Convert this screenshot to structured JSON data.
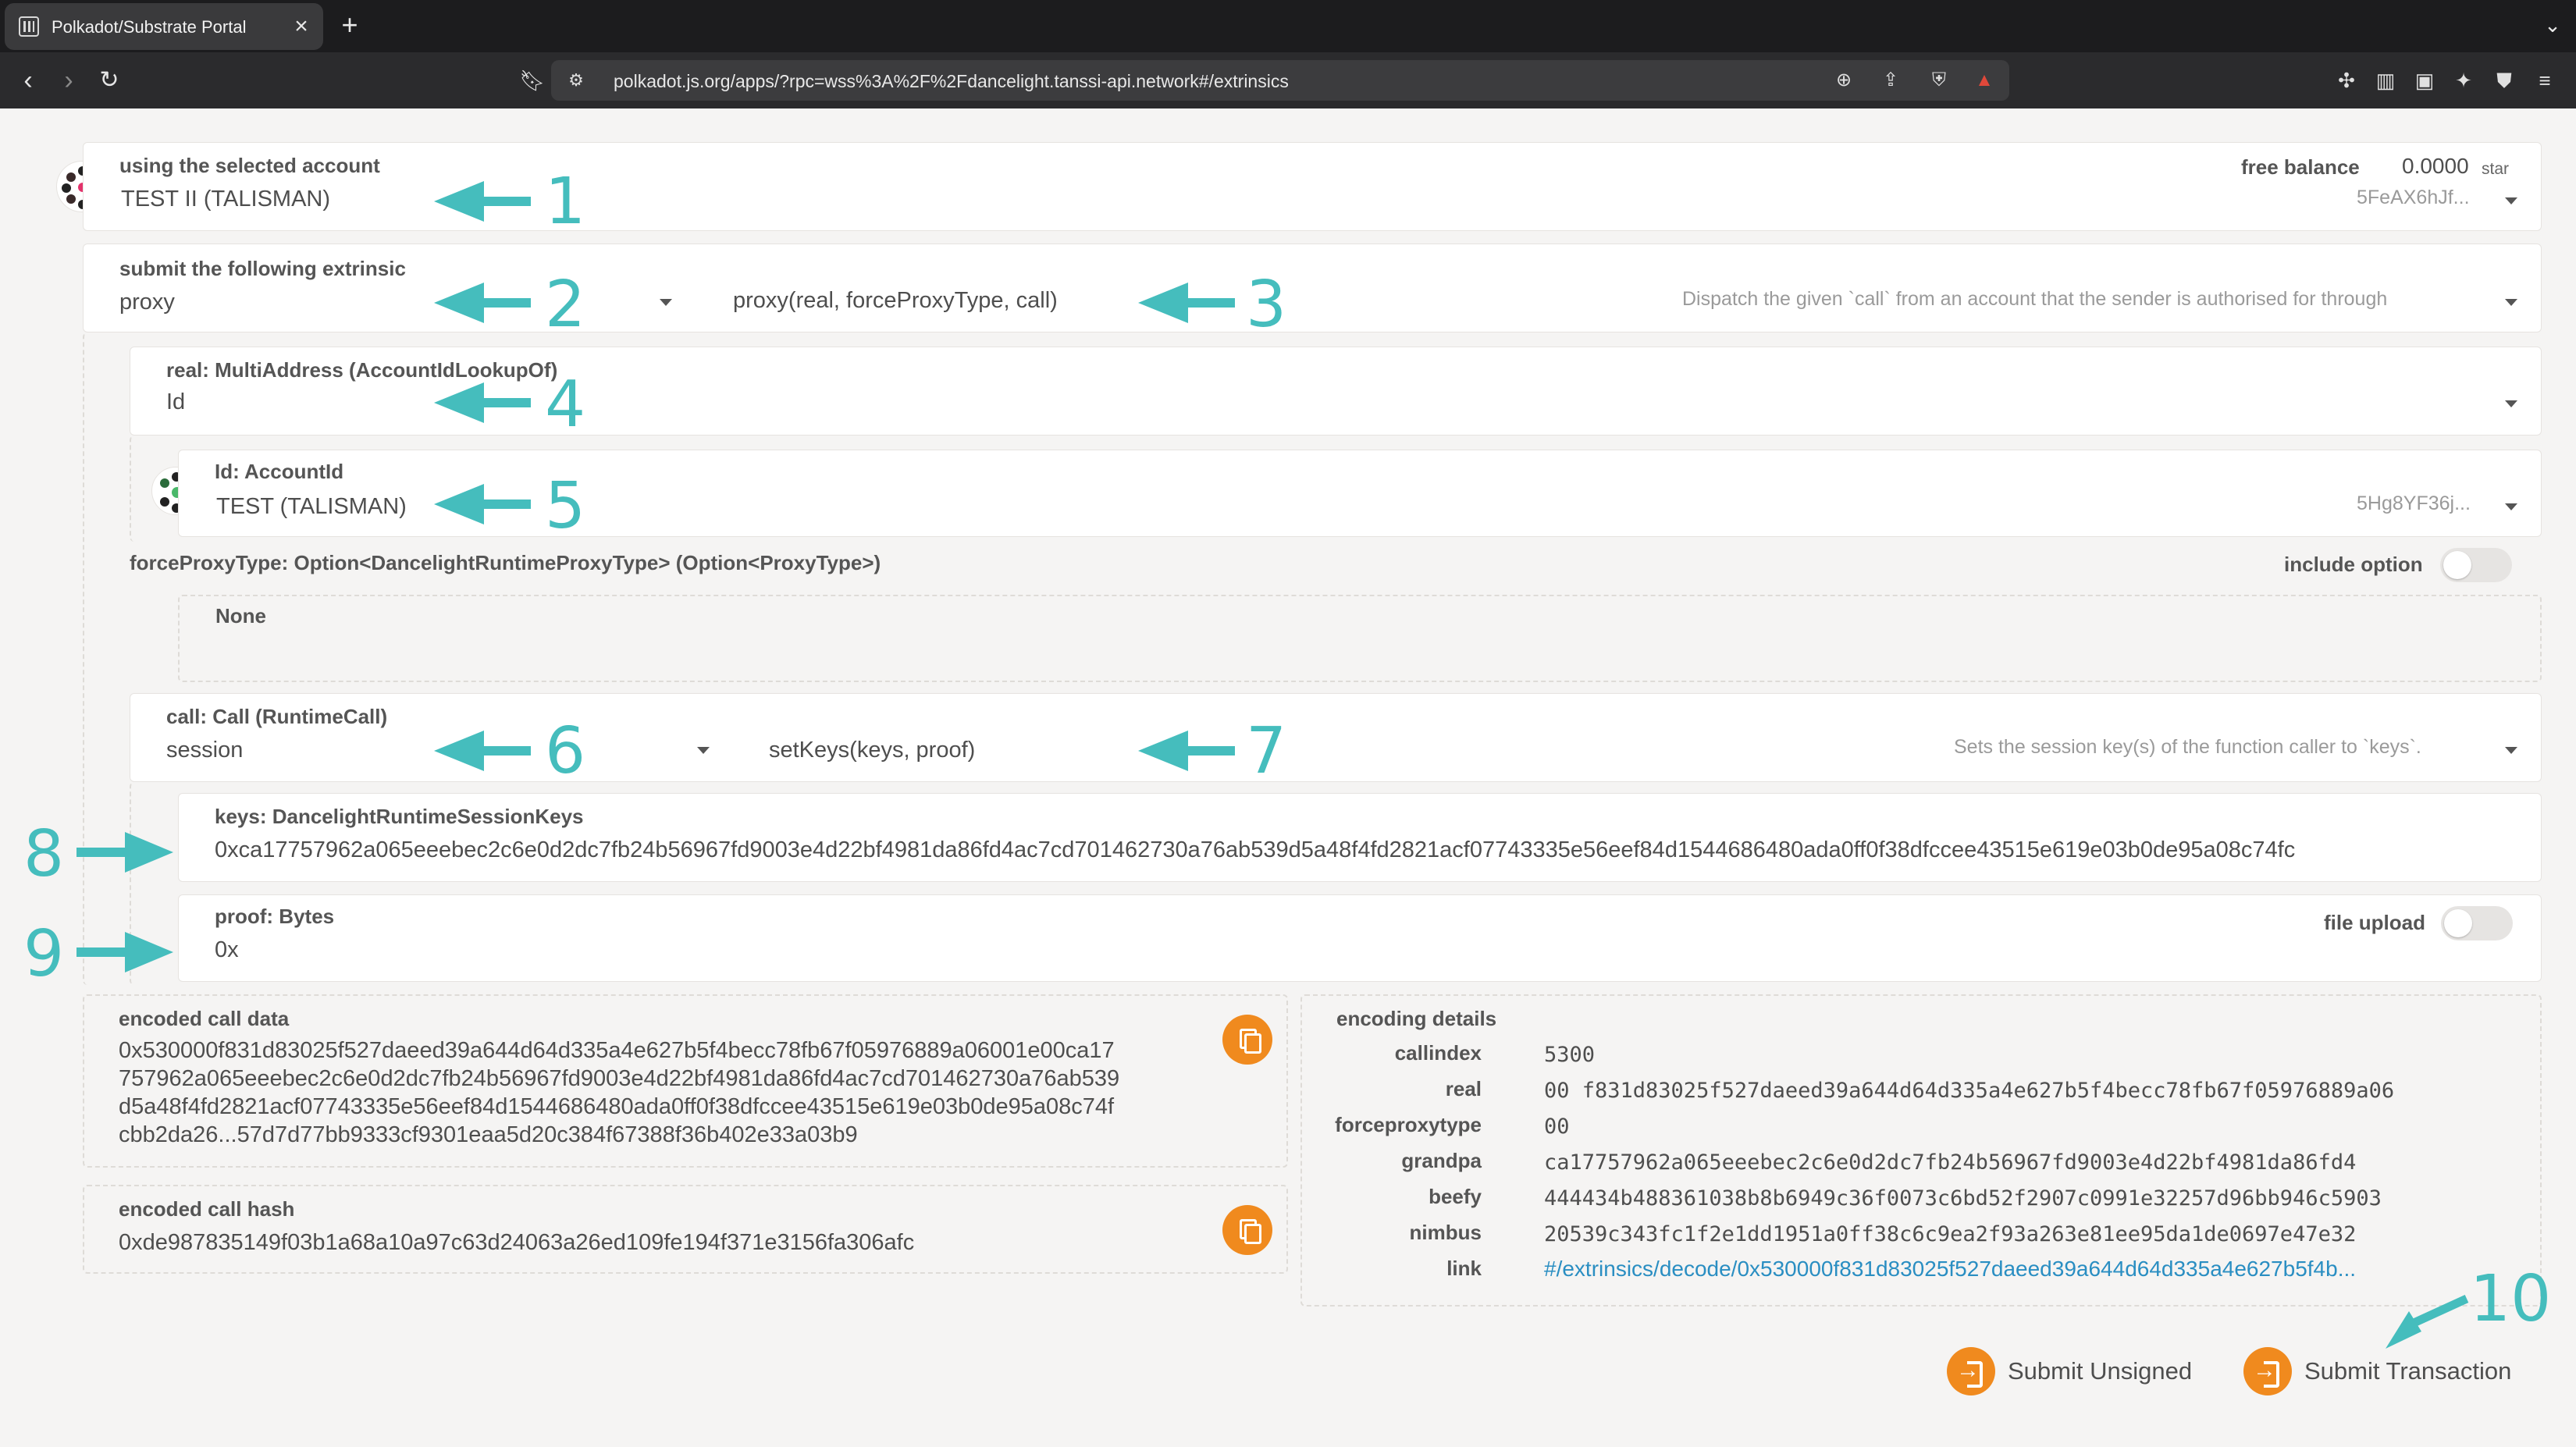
{
  "browser": {
    "tab_title": "Polkadot/Substrate Portal",
    "url": "polkadot.js.org/apps/?rpc=wss%3A%2F%2Fdancelight.tanssi-api.network#/extrinsics"
  },
  "account": {
    "label": "using the selected account",
    "name": "TEST II (TALISMAN)",
    "balance_label": "free balance",
    "balance_value": "0.0000",
    "balance_unit": "star",
    "address_short": "5FeAX6hJf..."
  },
  "extrinsic": {
    "label": "submit the following extrinsic",
    "module": "proxy",
    "method": "proxy(real, forceProxyType, call)",
    "description": "Dispatch the given `call` from an account that the sender is authorised for through"
  },
  "real": {
    "label": "real: MultiAddress (AccountIdLookupOf)",
    "value": "Id"
  },
  "id": {
    "label": "Id: AccountId",
    "name": "TEST (TALISMAN)",
    "address_short": "5Hg8YF36j..."
  },
  "force_proxy": {
    "label": "forceProxyType: Option<DancelightRuntimeProxyType> (Option<ProxyType>)",
    "include_label": "include option",
    "value": "None"
  },
  "call": {
    "label": "call: Call (RuntimeCall)",
    "module": "session",
    "method": "setKeys(keys, proof)",
    "description": "Sets the session key(s) of the function caller to `keys`."
  },
  "keys": {
    "label": "keys: DancelightRuntimeSessionKeys",
    "value": "0xca17757962a065eeebec2c6e0d2dc7fb24b56967fd9003e4d22bf4981da86fd4ac7cd701462730a76ab539d5a48f4fd2821acf07743335e56eef84d1544686480ada0ff0f38dfccee43515e619e03b0de95a08c74fc"
  },
  "proof": {
    "label": "proof: Bytes",
    "value": "0x",
    "upload_label": "file upload"
  },
  "encoded_call_data": {
    "label": "encoded call data",
    "value": "0x530000f831d83025f527daeed39a644d64d335a4e627b5f4becc78fb67f05976889a06001e00ca17\n757962a065eeebec2c6e0d2dc7fb24b56967fd9003e4d22bf4981da86fd4ac7cd701462730a76ab539\nd5a48f4fd2821acf07743335e56eef84d1544686480ada0ff0f38dfccee43515e619e03b0de95a08c74f\ncbb2da26...57d7d77bb9333cf9301eaa5d20c384f67388f36b402e33a03b9"
  },
  "encoded_call_hash": {
    "label": "encoded call hash",
    "value": "0xde987835149f03b1a68a10a97c63d24063a26ed109fe194f371e3156fa306afc"
  },
  "encoding_details": {
    "label": "encoding details",
    "rows": [
      {
        "key": "callindex",
        "value": "5300"
      },
      {
        "key": "real",
        "value": "00 f831d83025f527daeed39a644d64d335a4e627b5f4becc78fb67f05976889a06"
      },
      {
        "key": "forceproxytype",
        "value": "00"
      },
      {
        "key": "grandpa",
        "value": "ca17757962a065eeebec2c6e0d2dc7fb24b56967fd9003e4d22bf4981da86fd4"
      },
      {
        "key": "beefy",
        "value": "444434b488361038b8b6949c36f0073c6bd52f2907c0991e32257d96bb946c5903"
      },
      {
        "key": "nimbus",
        "value": "20539c343fc1f2e1dd1951a0ff38c6c9ea2f93a263e81ee95da1de0697e47e32"
      }
    ],
    "link_key": "link",
    "link_value": "#/extrinsics/decode/0x530000f831d83025f527daeed39a644d64d335a4e627b5f4b..."
  },
  "actions": {
    "submit_unsigned": "Submit Unsigned",
    "submit_transaction": "Submit Transaction"
  },
  "annotations": [
    "1",
    "2",
    "3",
    "4",
    "5",
    "6",
    "7",
    "8",
    "9",
    "10"
  ],
  "colors": {
    "accent": "#f08a1e",
    "annotation": "#45bdbd",
    "link": "#2a8ec2"
  }
}
